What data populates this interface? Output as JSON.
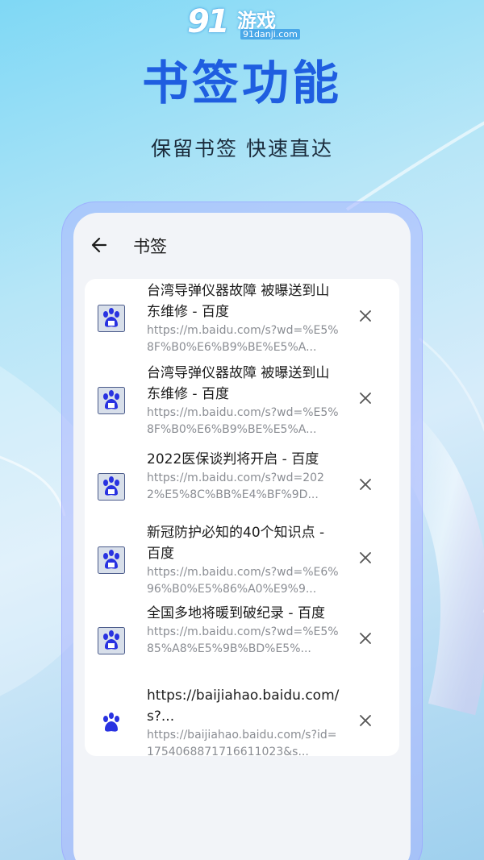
{
  "logo": {
    "number": "91",
    "name": "游戏",
    "domain": "91danji.com"
  },
  "headline": "书签功能",
  "subline": "保留书签 快速直达",
  "app": {
    "page_title": "书签",
    "back_icon": "arrow-left-icon",
    "close_icon": "close-icon"
  },
  "bookmarks": [
    {
      "title": "台湾导弹仪器故障 被曝送到山东维修 - 百度",
      "url": "https://m.baidu.com/s?wd=%E5%8F%B0%E6%B9%BE%E5%A...",
      "icon": "baidu-paw-icon"
    },
    {
      "title": "台湾导弹仪器故障 被曝送到山东维修 - 百度",
      "url": "https://m.baidu.com/s?wd=%E5%8F%B0%E6%B9%BE%E5%A...",
      "icon": "baidu-paw-icon"
    },
    {
      "title": "2022医保谈判将开启 - 百度",
      "url": "https://m.baidu.com/s?wd=2022%E5%8C%BB%E4%BF%9D...",
      "icon": "baidu-paw-icon"
    },
    {
      "title": "新冠防护必知的40个知识点 - 百度",
      "url": "https://m.baidu.com/s?wd=%E6%96%B0%E5%86%A0%E9%9...",
      "icon": "baidu-paw-icon"
    },
    {
      "title": "全国多地将暖到破纪录 - 百度",
      "url": "https://m.baidu.com/s?wd=%E5%85%A8%E5%9B%BD%E5%...",
      "icon": "baidu-paw-icon"
    },
    {
      "title": "https://baijiahao.baidu.com/s?...",
      "url": "https://baijiahao.baidu.com/s?id=1754068871716611023&s...",
      "icon": "baidu-paw-icon"
    }
  ],
  "colors": {
    "headline": "#1f5ee0",
    "baidu_blue": "#2932e1",
    "screen_bg": "#f2f4f8"
  }
}
